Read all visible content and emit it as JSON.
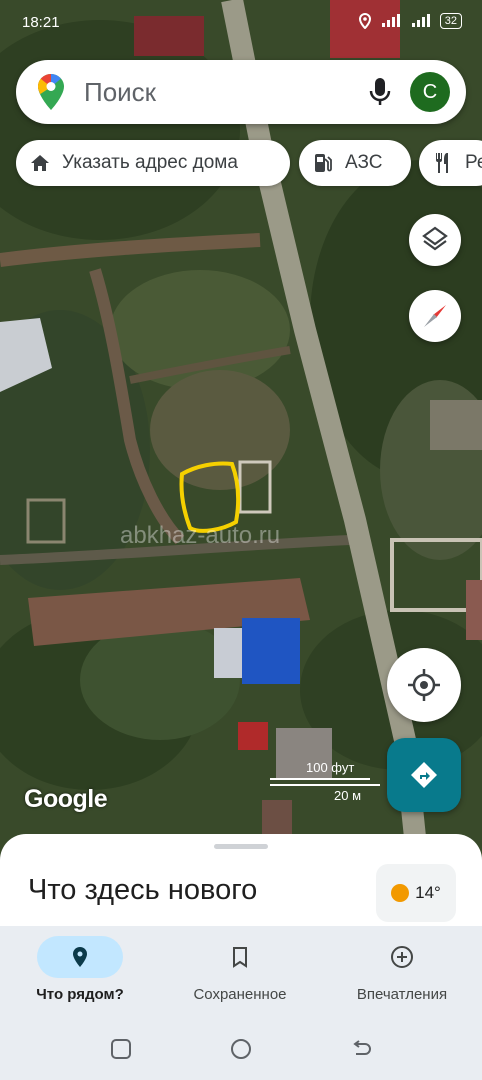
{
  "status_bar": {
    "time": "18:21",
    "battery": "32"
  },
  "search": {
    "placeholder": "Поиск",
    "avatar_letter": "С"
  },
  "chips": [
    {
      "label": "Указать адрес дома",
      "icon": "home-icon"
    },
    {
      "label": "АЗС",
      "icon": "gas-station-icon"
    },
    {
      "label": "Ре",
      "icon": "restaurant-icon"
    }
  ],
  "map": {
    "google_logo": "Google",
    "watermark": "abkhaz-auto.ru",
    "scale_imperial": "100 фут",
    "scale_metric": "20 м",
    "controls": [
      "layers-icon",
      "compass-icon",
      "my-location-icon",
      "directions-icon"
    ],
    "annotation_color": "#f5d000"
  },
  "sheet": {
    "title": "Что здесь нового",
    "temperature": "14°"
  },
  "bottom_nav": [
    {
      "label": "Что рядом?",
      "icon": "explore-pin-icon",
      "active": true
    },
    {
      "label": "Сохраненное",
      "icon": "bookmark-icon",
      "active": false
    },
    {
      "label": "Впечатления",
      "icon": "add-circle-icon",
      "active": false
    }
  ],
  "colors": {
    "accent": "#087a8c",
    "active_tab": "#c2e7ff",
    "avatar": "#1e6b1f"
  }
}
